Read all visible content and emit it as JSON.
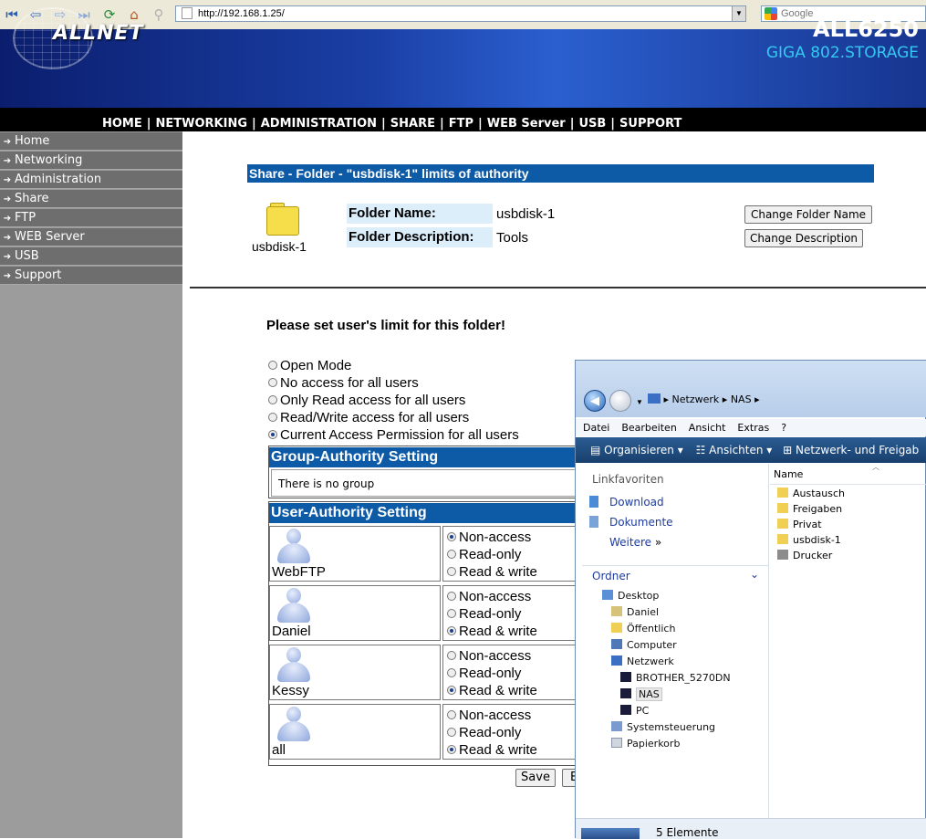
{
  "browser": {
    "url": "http://192.168.1.25/",
    "search_placeholder": "Google",
    "icons": [
      "first-icon",
      "back-icon",
      "forward-icon",
      "last-icon",
      "reload-icon",
      "home-icon",
      "pin-icon"
    ]
  },
  "header": {
    "logo_text": "ALLNET",
    "model": "ALL6250",
    "subtitle": "GIGA 802.STORAGE",
    "menu": [
      "HOME",
      "NETWORKING",
      "ADMINISTRATION",
      "SHARE",
      "FTP",
      "WEB Server",
      "USB",
      "SUPPORT"
    ]
  },
  "sidebar": {
    "items": [
      {
        "label": "Home"
      },
      {
        "label": "Networking"
      },
      {
        "label": "Administration"
      },
      {
        "label": "Share"
      },
      {
        "label": "FTP"
      },
      {
        "label": "WEB Server"
      },
      {
        "label": "USB"
      },
      {
        "label": "Support"
      }
    ]
  },
  "main": {
    "title": "Share - Folder - \"usbdisk-1\" limits of authority",
    "folder_caption": "usbdisk-1",
    "folder_name_label": "Folder Name:",
    "folder_name_value": "usbdisk-1",
    "folder_desc_label": "Folder Description:",
    "folder_desc_value": "Tools",
    "change_name_button": "Change Folder Name",
    "change_desc_button": "Change Description",
    "prompt": "Please set user's limit for this folder!",
    "modes": [
      {
        "label": "Open Mode",
        "selected": false
      },
      {
        "label": "No access for all users",
        "selected": false
      },
      {
        "label": "Only Read access for all users",
        "selected": false
      },
      {
        "label": "Read/Write access for all users",
        "selected": false
      },
      {
        "label": "Current Access Permission for all users",
        "selected": true
      }
    ],
    "group_header": "Group-Authority Setting",
    "group_empty": "There is no group",
    "user_header": "User-Authority Setting",
    "permission_labels": [
      "Non-access",
      "Read-only",
      "Read & write"
    ],
    "users": [
      {
        "name": "WebFTP",
        "selected": 0
      },
      {
        "name": "Daniel",
        "selected": 2
      },
      {
        "name": "Kessy",
        "selected": 2
      },
      {
        "name": "all",
        "selected": 2
      }
    ],
    "save_button": "Save",
    "partial_button": "B"
  },
  "explorer": {
    "path": [
      "Netzwerk",
      "NAS"
    ],
    "menu": [
      "Datei",
      "Bearbeiten",
      "Ansicht",
      "Extras",
      "?"
    ],
    "commands": [
      "Organisieren",
      "Ansichten",
      "Netzwerk- und Freigab"
    ],
    "favorites_title": "Linkfavoriten",
    "favorites": [
      "Download",
      "Dokumente",
      "Weitere"
    ],
    "folders_title": "Ordner",
    "tree": [
      {
        "label": "Desktop",
        "level": 0
      },
      {
        "label": "Daniel",
        "level": 1
      },
      {
        "label": "Öffentlich",
        "level": 1
      },
      {
        "label": "Computer",
        "level": 1
      },
      {
        "label": "Netzwerk",
        "level": 1
      },
      {
        "label": "BROTHER_5270DN",
        "level": 2
      },
      {
        "label": "NAS",
        "level": 2,
        "selected": true
      },
      {
        "label": "PC",
        "level": 2
      },
      {
        "label": "Systemsteuerung",
        "level": 1
      },
      {
        "label": "Papierkorb",
        "level": 1
      }
    ],
    "column_name": "Name",
    "files": [
      "Austausch",
      "Freigaben",
      "Privat",
      "usbdisk-1",
      "Drucker"
    ],
    "status": "5 Elemente"
  },
  "colors": {
    "section_blue": "#0d5aa7",
    "sidebar_item": "#6e6e6e",
    "sidebar_bg": "#9c9c9c",
    "label_bg": "#ddeefb"
  }
}
